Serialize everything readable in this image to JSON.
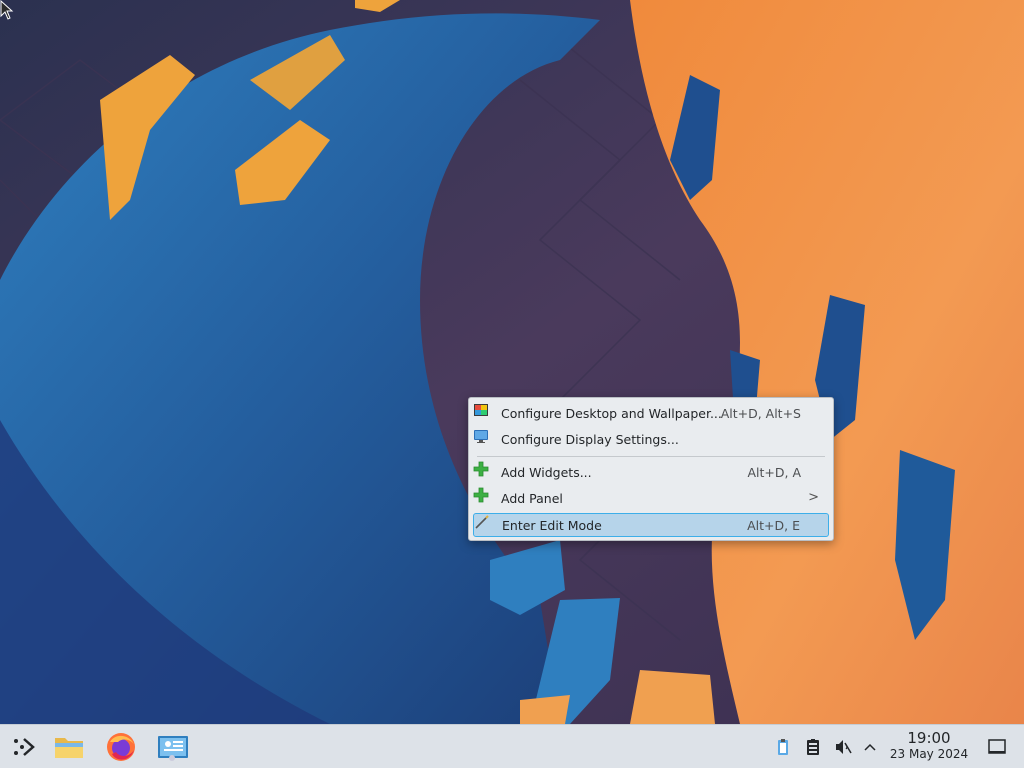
{
  "desktop": {
    "wallpaper_icon": "kde-wallpaper"
  },
  "context_menu": {
    "items": [
      {
        "label": "Configure Desktop and Wallpaper...",
        "shortcut": "Alt+D, Alt+S",
        "icon": "configure-desktop-icon"
      },
      {
        "label": "Configure Display Settings...",
        "shortcut": "",
        "icon": "display-settings-icon"
      },
      {
        "label": "Add Widgets...",
        "shortcut": "Alt+D, A",
        "icon": "add-icon"
      },
      {
        "label": "Add Panel",
        "shortcut": "",
        "icon": "add-icon",
        "submenu_arrow": ">"
      },
      {
        "label": "Enter Edit Mode",
        "shortcut": "Alt+D, E",
        "icon": "edit-mode-icon",
        "highlighted": true
      }
    ]
  },
  "taskbar": {
    "launcher_icon": "kde-launcher-icon",
    "pinned": [
      {
        "name": "file-manager-icon"
      },
      {
        "name": "firefox-icon"
      },
      {
        "name": "system-settings-icon"
      }
    ],
    "tray": [
      {
        "name": "clipboard-paste-icon"
      },
      {
        "name": "clipboard-icon"
      },
      {
        "name": "volume-muted-icon"
      },
      {
        "name": "expand-tray-icon"
      }
    ],
    "clock": {
      "time": "19:00",
      "date": "23 May 2024"
    },
    "show_desktop_icon": "show-desktop-icon"
  },
  "colors": {
    "taskbar_bg": "#dde2e8",
    "menu_bg": "#e9ecef",
    "highlight": "#b6d4ea",
    "accent": "#3daee9"
  }
}
